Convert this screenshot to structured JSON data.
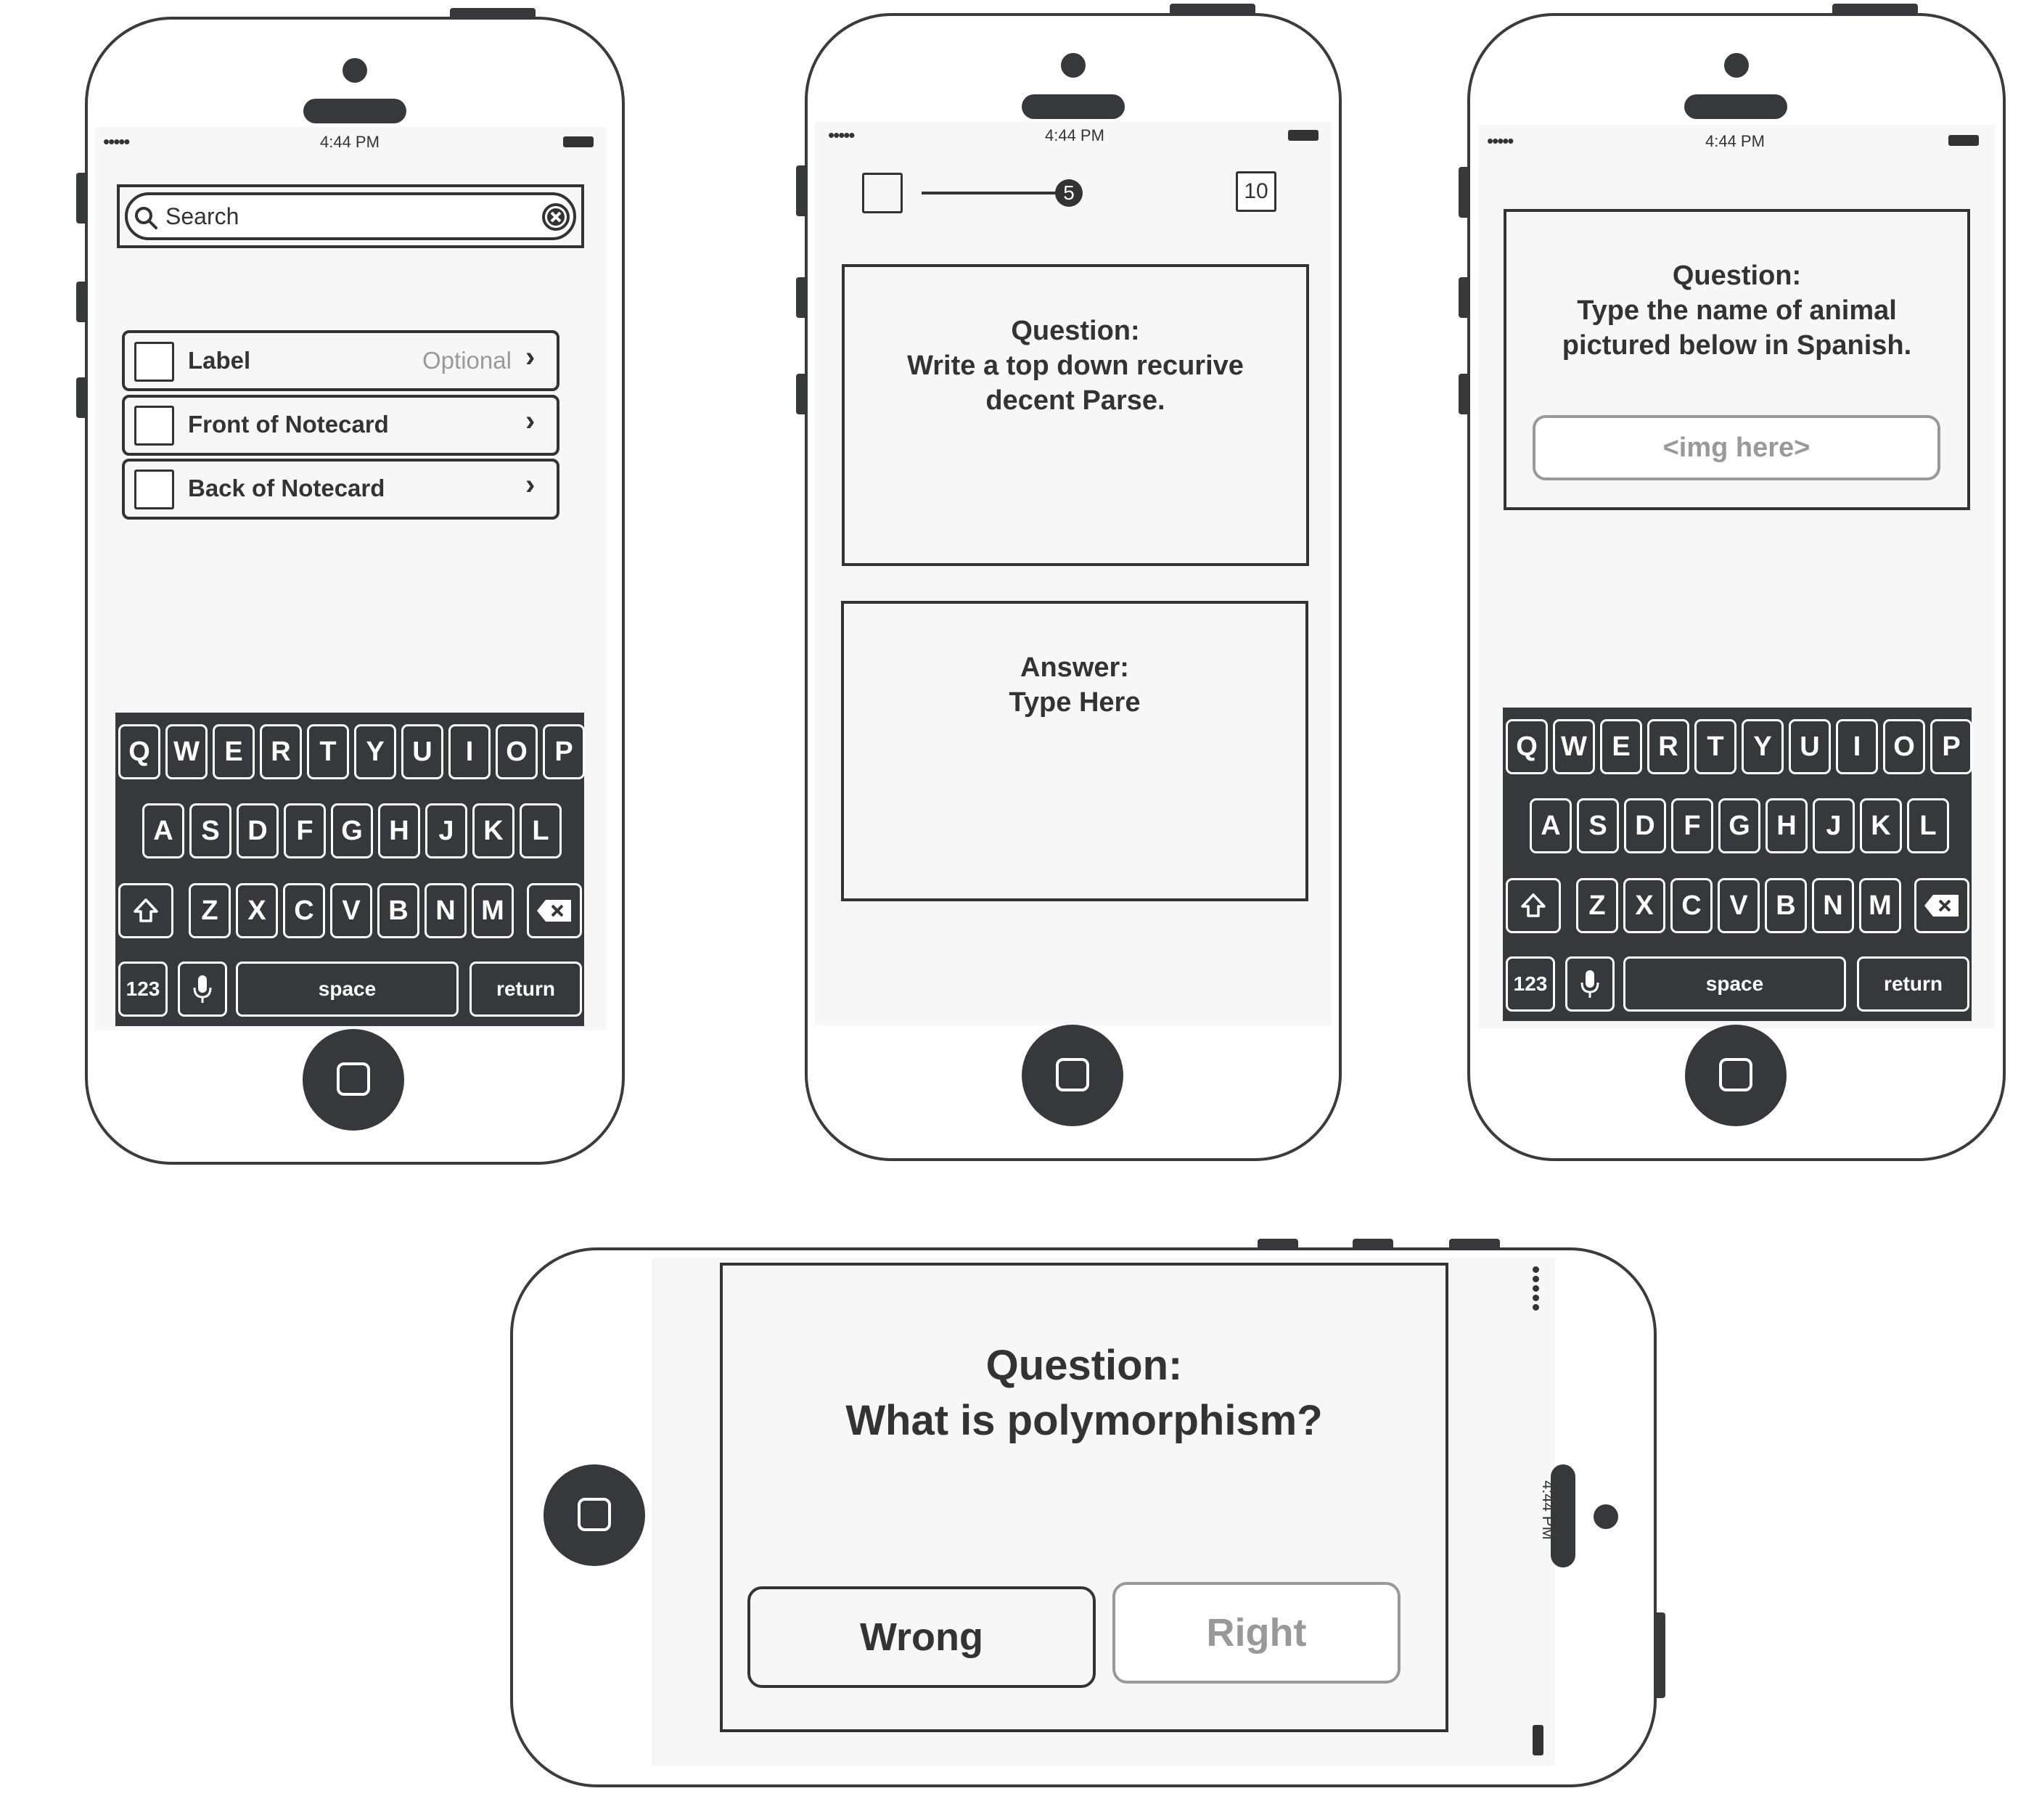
{
  "status": {
    "time": "4:44 PM",
    "signal": "•••••"
  },
  "phone1": {
    "search_placeholder": "Search",
    "rows": [
      {
        "label": "Label",
        "detail": "Optional"
      },
      {
        "label": "Front of Notecard",
        "detail": ""
      },
      {
        "label": "Back of Notecard",
        "detail": ""
      }
    ]
  },
  "phone2": {
    "slider_value": "5",
    "counter": "10",
    "question_title": "Question:",
    "question_text": "Write a top down recurive decent Parse.",
    "answer_title": "Answer:",
    "answer_placeholder": "Type Here"
  },
  "phone3": {
    "question_title": "Question:",
    "question_text": "Type the name of animal pictured below in Spanish.",
    "image_placeholder": "<img here>"
  },
  "phone4": {
    "question_title": "Question:",
    "question_text": "What is polymorphism?",
    "wrong_label": "Wrong",
    "right_label": "Right"
  },
  "keyboard": {
    "row1": [
      "Q",
      "W",
      "E",
      "R",
      "T",
      "Y",
      "U",
      "I",
      "O",
      "P"
    ],
    "row2": [
      "A",
      "S",
      "D",
      "F",
      "G",
      "H",
      "J",
      "K",
      "L"
    ],
    "row3": [
      "Z",
      "X",
      "C",
      "V",
      "B",
      "N",
      "M"
    ],
    "numbers": "123",
    "space": "space",
    "return": "return"
  },
  "icons": {
    "search": "search-icon",
    "clear": "clear-icon",
    "chevron": "chevron-right-icon",
    "shift": "shift-icon",
    "delete": "delete-icon",
    "mic": "microphone-icon",
    "home": "home-button-icon"
  }
}
